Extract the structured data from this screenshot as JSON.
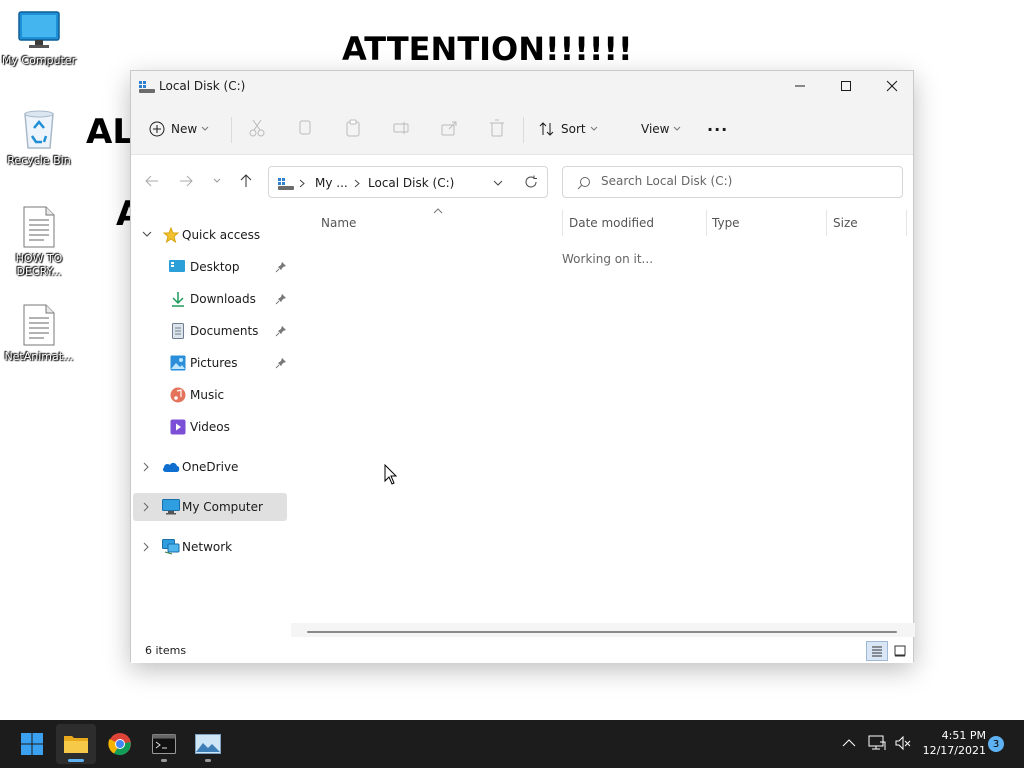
{
  "desktop": {
    "wallpaper_text": {
      "attention": "ATTENTION!!!!!!",
      "al": "AL",
      "a": "A"
    },
    "icons": [
      {
        "label": "My Computer",
        "icon": "monitor-icon"
      },
      {
        "label": "Recycle Bin",
        "icon": "recycle-bin-icon"
      },
      {
        "label": "HOW TO DECRY...",
        "line1": "HOW TO",
        "line2": "DECRY...",
        "icon": "text-file-icon"
      },
      {
        "label": "NetAnimat...",
        "icon": "text-file-icon"
      }
    ]
  },
  "window": {
    "title": "Local Disk (C:)",
    "commands": {
      "new": "New",
      "sort": "Sort",
      "view": "View",
      "more": "···"
    },
    "address": {
      "segment1": "My ...",
      "segment2": "Local Disk (C:)"
    },
    "search": {
      "placeholder": "Search Local Disk (C:)"
    },
    "nav": {
      "quick_access": "Quick access",
      "items": [
        {
          "label": "Desktop",
          "pinned": true
        },
        {
          "label": "Downloads",
          "pinned": true
        },
        {
          "label": "Documents",
          "pinned": true
        },
        {
          "label": "Pictures",
          "pinned": true
        },
        {
          "label": "Music",
          "pinned": false
        },
        {
          "label": "Videos",
          "pinned": false
        }
      ],
      "onedrive": "OneDrive",
      "my_computer": "My Computer",
      "network": "Network"
    },
    "columns": {
      "name": "Name",
      "date_modified": "Date modified",
      "type": "Type",
      "size": "Size"
    },
    "loading_text": "Working on it...",
    "status": {
      "items": "6 items"
    }
  },
  "taskbar": {
    "apps": [
      "start",
      "file-explorer",
      "chrome",
      "terminal",
      "image-viewer"
    ],
    "time": "4:51 PM",
    "date": "12/17/2021",
    "notification_count": "3"
  },
  "colors": {
    "accent": "#0067c0",
    "taskbar": "#1c1c1c",
    "selected_nav": "#e0e0e0"
  }
}
